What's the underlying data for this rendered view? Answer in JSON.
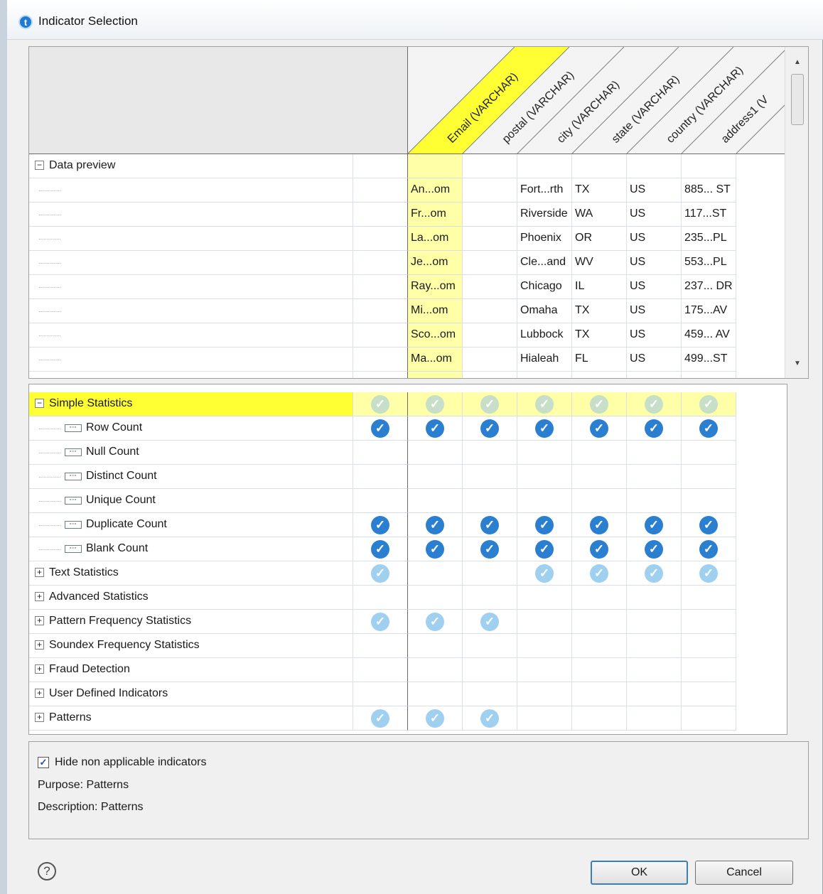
{
  "window": {
    "title": "Indicator Selection",
    "app_icon": "talend-icon"
  },
  "columns": [
    "Email (VARCHAR)",
    "postal (VARCHAR)",
    "city (VARCHAR)",
    "state (VARCHAR)",
    "country (VARCHAR)",
    "address1 (V"
  ],
  "preview": {
    "label": "Data preview",
    "rows": [
      [
        "An...om",
        "",
        "Fort...rth",
        "TX",
        "US",
        "885... ST"
      ],
      [
        "Fr...om",
        "",
        "Riverside",
        "WA",
        "US",
        "117...ST"
      ],
      [
        "La...om",
        "",
        "Phoenix",
        "OR",
        "US",
        "235...PL"
      ],
      [
        "Je...om",
        "",
        "Cle...and",
        "WV",
        "US",
        "553...PL"
      ],
      [
        "Ray...om",
        "",
        "Chicago",
        "IL",
        "US",
        "237... DR"
      ],
      [
        "Mi...om",
        "",
        "Omaha",
        "TX",
        "US",
        "175...AV"
      ],
      [
        "Sco...om",
        "",
        "Lubbock",
        "TX",
        "US",
        "459... AV"
      ],
      [
        "Ma...om",
        "",
        "Hialeah",
        "FL",
        "US",
        "499...ST"
      ]
    ]
  },
  "indicators": {
    "simple": {
      "label": "Simple Statistics",
      "checks": [
        "faded",
        "faded",
        "faded",
        "faded",
        "faded",
        "faded",
        "faded"
      ]
    },
    "children": [
      {
        "label": "Row Count",
        "checks": [
          "on",
          "on",
          "on",
          "on",
          "on",
          "on",
          "on"
        ]
      },
      {
        "label": "Null Count",
        "checks": [
          "",
          "",
          "",
          "",
          "",
          "",
          ""
        ]
      },
      {
        "label": "Distinct Count",
        "checks": [
          "",
          "",
          "",
          "",
          "",
          "",
          ""
        ]
      },
      {
        "label": "Unique Count",
        "checks": [
          "",
          "",
          "",
          "",
          "",
          "",
          ""
        ]
      },
      {
        "label": "Duplicate Count",
        "checks": [
          "on",
          "on",
          "on",
          "on",
          "on",
          "on",
          "on"
        ]
      },
      {
        "label": "Blank Count",
        "checks": [
          "on",
          "on",
          "on",
          "on",
          "on",
          "on",
          "on"
        ]
      }
    ],
    "groups": [
      {
        "label": "Text Statistics",
        "checks": [
          "faded",
          "",
          "",
          "faded",
          "faded",
          "faded",
          "faded"
        ]
      },
      {
        "label": "Advanced Statistics",
        "checks": [
          "",
          "",
          "",
          "",
          "",
          "",
          ""
        ]
      },
      {
        "label": "Pattern Frequency Statistics",
        "checks": [
          "faded",
          "faded",
          "faded",
          "",
          "",
          "",
          ""
        ]
      },
      {
        "label": "Soundex Frequency Statistics",
        "checks": [
          "",
          "",
          "",
          "",
          "",
          "",
          ""
        ]
      },
      {
        "label": "Fraud Detection",
        "checks": [
          "",
          "",
          "",
          "",
          "",
          "",
          ""
        ]
      },
      {
        "label": "User Defined Indicators",
        "checks": [
          "",
          "",
          "",
          "",
          "",
          "",
          ""
        ]
      },
      {
        "label": "Patterns",
        "checks": [
          "faded",
          "faded",
          "faded",
          "",
          "",
          "",
          ""
        ]
      }
    ]
  },
  "info": {
    "hide_label": "Hide non applicable indicators",
    "purpose": "Purpose: Patterns",
    "description": "Description: Patterns"
  },
  "buttons": {
    "ok": "OK",
    "cancel": "Cancel",
    "help": "?"
  },
  "colors": {
    "highlight": "#ffff33",
    "check": "#2b7fd0",
    "check_faded": "#9fd0f0"
  }
}
